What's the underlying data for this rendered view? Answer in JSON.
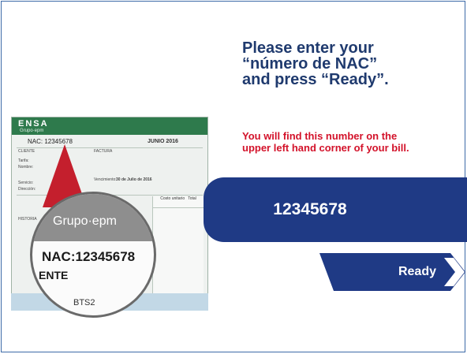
{
  "instructions": {
    "title_lines": [
      "Please enter your",
      "“número de NAC”",
      "and press “Ready”."
    ],
    "hint_lines": [
      "You will find this number on the",
      "upper left hand corner of your bill."
    ]
  },
  "nac_input": {
    "value": "12345678"
  },
  "ready_button": {
    "label": "Ready"
  },
  "bill": {
    "brand": "ENSA",
    "brand_sub": "Grupo·epm",
    "nac_small": "NAC: 12345678",
    "date": "JUNIO 2016",
    "labels": [
      "CLIENTE",
      "FACTURA",
      "Tarifa:",
      "Nombre:",
      "Servicio:",
      "Dirección:",
      "Vencimiento:",
      "30 de Julio de 2016",
      "HISTORIA",
      "Costo unitario",
      "Total"
    ]
  },
  "magnifier": {
    "brand": "Grupo·epm",
    "nac": "NAC:12345678",
    "ente": "ENTE",
    "bts": "BTS2"
  },
  "colors": {
    "title": "#1f3a6e",
    "hint": "#d3122a",
    "accent": "#1f3a85",
    "bill_green": "#2e7a4c"
  }
}
